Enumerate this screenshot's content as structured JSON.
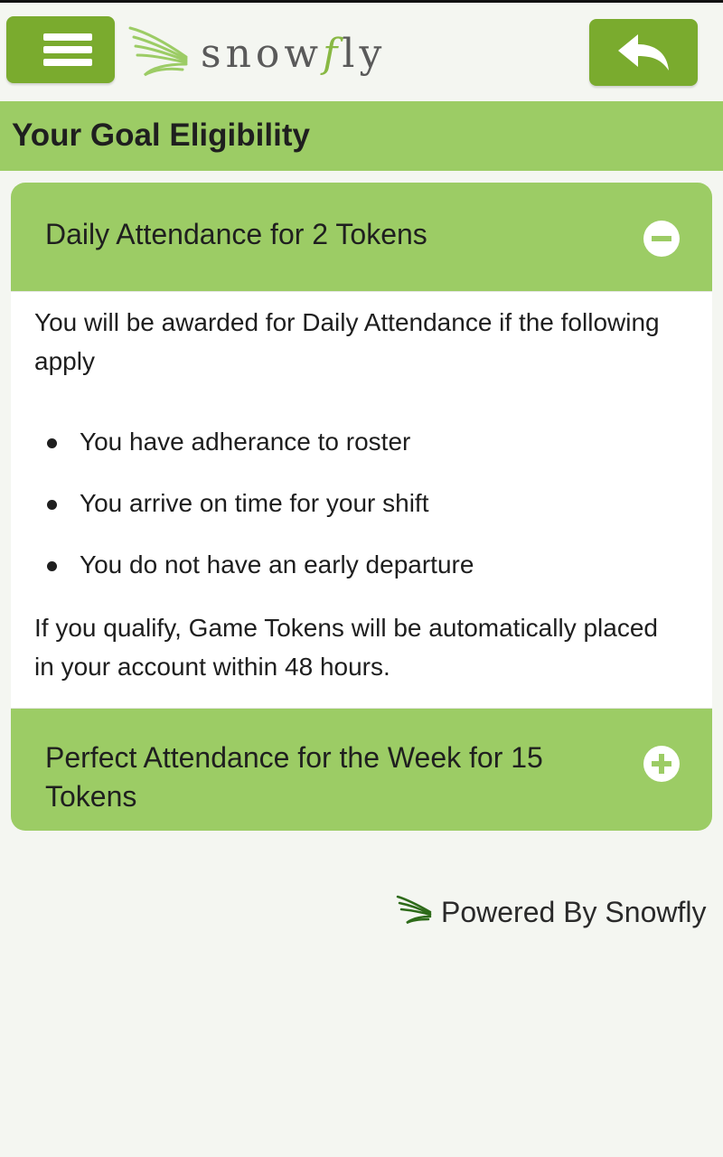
{
  "header": {
    "menu_icon": "hamburger-menu-icon",
    "logo_prefix": "snow",
    "logo_f": "f",
    "logo_suffix": "ly",
    "back_icon": "reply-arrow-icon"
  },
  "page": {
    "title": "Your Goal Eligibility"
  },
  "accordion": {
    "sections": [
      {
        "title": "Daily Attendance for 2 Tokens",
        "expanded": true,
        "toggle_icon": "minus-circle-icon",
        "intro": "You will be awarded for Daily Attendance if the following apply",
        "criteria": [
          "You have adherance to roster",
          "You arrive on time for your shift",
          "You do not have an early departure"
        ],
        "outro": "If you qualify, Game Tokens will be automatically placed in your account within 48 hours."
      },
      {
        "title": "Perfect Attendance for the Week for 15 Tokens",
        "expanded": false,
        "toggle_icon": "plus-circle-icon"
      }
    ]
  },
  "footer": {
    "powered_by": "Powered By Snowfly",
    "logo_icon": "snowfly-wing-icon"
  },
  "colors": {
    "button_green": "#7aab2e",
    "bar_green": "#9ccc65",
    "page_background": "#f4f6f1"
  }
}
